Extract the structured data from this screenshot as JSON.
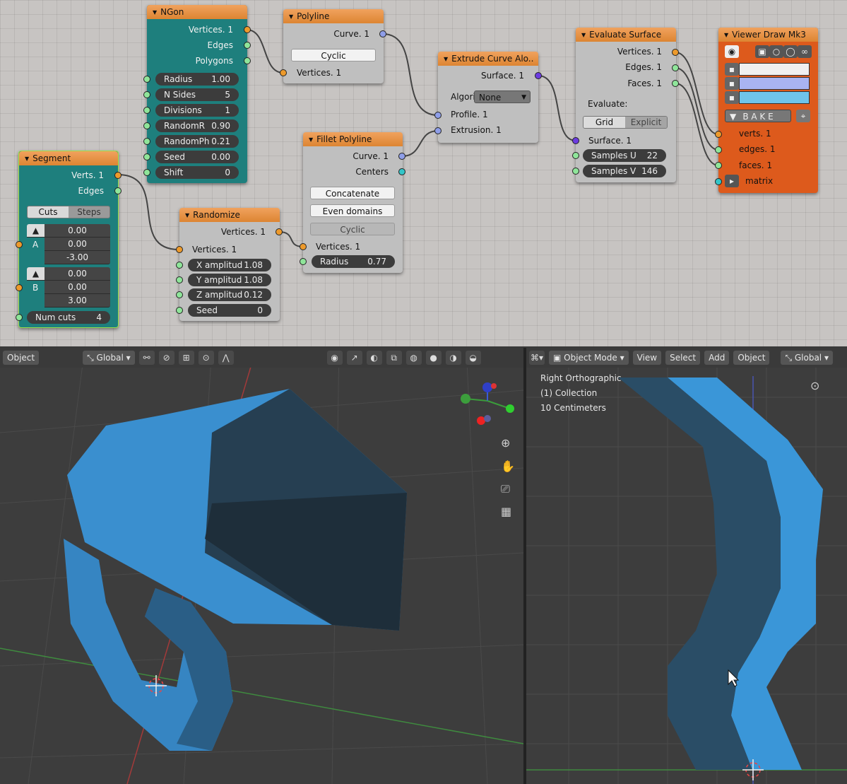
{
  "nodes": {
    "ngon": {
      "title": "NGon",
      "outputs": [
        "Vertices. 1",
        "Edges",
        "Polygons"
      ],
      "fields": [
        {
          "label": "Radius",
          "value": "1.00"
        },
        {
          "label": "N Sides",
          "value": "5"
        },
        {
          "label": "Divisions",
          "value": "1"
        },
        {
          "label": "RandomR",
          "value": "0.90"
        },
        {
          "label": "RandomPh",
          "value": "0.21"
        },
        {
          "label": "Seed",
          "value": "0.00"
        },
        {
          "label": "Shift",
          "value": "0"
        }
      ]
    },
    "polyline": {
      "title": "Polyline",
      "output": "Curve. 1",
      "cyclic": "Cyclic",
      "input": "Vertices. 1"
    },
    "segment": {
      "title": "Segment",
      "outputs": [
        "Verts. 1",
        "Edges"
      ],
      "tab_cuts": "Cuts",
      "tab_steps": "Steps",
      "a_label": "A",
      "a_values": [
        "0.00",
        "0.00",
        "-3.00"
      ],
      "b_label": "B",
      "b_values": [
        "0.00",
        "0.00",
        "3.00"
      ],
      "num_cuts_label": "Num cuts",
      "num_cuts_value": "4"
    },
    "randomize": {
      "title": "Randomize",
      "output": "Vertices. 1",
      "input": "Vertices. 1",
      "fields": [
        {
          "label": "X amplitud",
          "value": "1.08"
        },
        {
          "label": "Y amplitud",
          "value": "1.08"
        },
        {
          "label": "Z amplitud",
          "value": "0.12"
        },
        {
          "label": "Seed",
          "value": "0"
        }
      ]
    },
    "fillet": {
      "title": "Fillet Polyline",
      "outputs": [
        "Curve. 1",
        "Centers"
      ],
      "concatenate": "Concatenate",
      "even_domains": "Even domains",
      "cyclic": "Cyclic",
      "input": "Vertices. 1",
      "radius_label": "Radius",
      "radius_value": "0.77"
    },
    "extrude": {
      "title": "Extrude Curve Alo..",
      "output": "Surface. 1",
      "algo_label": "Algori",
      "algo_value": "None",
      "inputs": [
        "Profile. 1",
        "Extrusion. 1"
      ]
    },
    "evaluate": {
      "title": "Evaluate Surface",
      "outputs": [
        "Vertices. 1",
        "Edges. 1",
        "Faces. 1"
      ],
      "evaluate_label": "Evaluate:",
      "tab_grid": "Grid",
      "tab_explicit": "Explicit",
      "input": "Surface. 1",
      "samples_u_label": "Samples U",
      "samples_u_value": "22",
      "samples_v_label": "Samples V",
      "samples_v_value": "146"
    },
    "viewer": {
      "title": "Viewer Draw Mk3",
      "bake": "B A K E",
      "inputs": [
        "verts. 1",
        "edges. 1",
        "faces. 1",
        "matrix"
      ],
      "swatch_colors": [
        "#f0f0f0",
        "#a9b4f2",
        "#6fc4ea"
      ]
    }
  },
  "viewport_left": {
    "mode_label": "Object",
    "orientation": "Global"
  },
  "viewport_right": {
    "mode_label": "Object Mode",
    "menu": [
      "View",
      "Select",
      "Add",
      "Object"
    ],
    "orientation": "Global",
    "info": [
      "Right Orthographic",
      "(1) Collection",
      "10 Centimeters"
    ]
  },
  "colors": {
    "node_bg": "#c7c4c2",
    "teal_node": "#1e7f7d",
    "viewer_node": "#dd5a1c",
    "mesh_light": "#3a8fcf",
    "mesh_dark": "#243f55"
  }
}
